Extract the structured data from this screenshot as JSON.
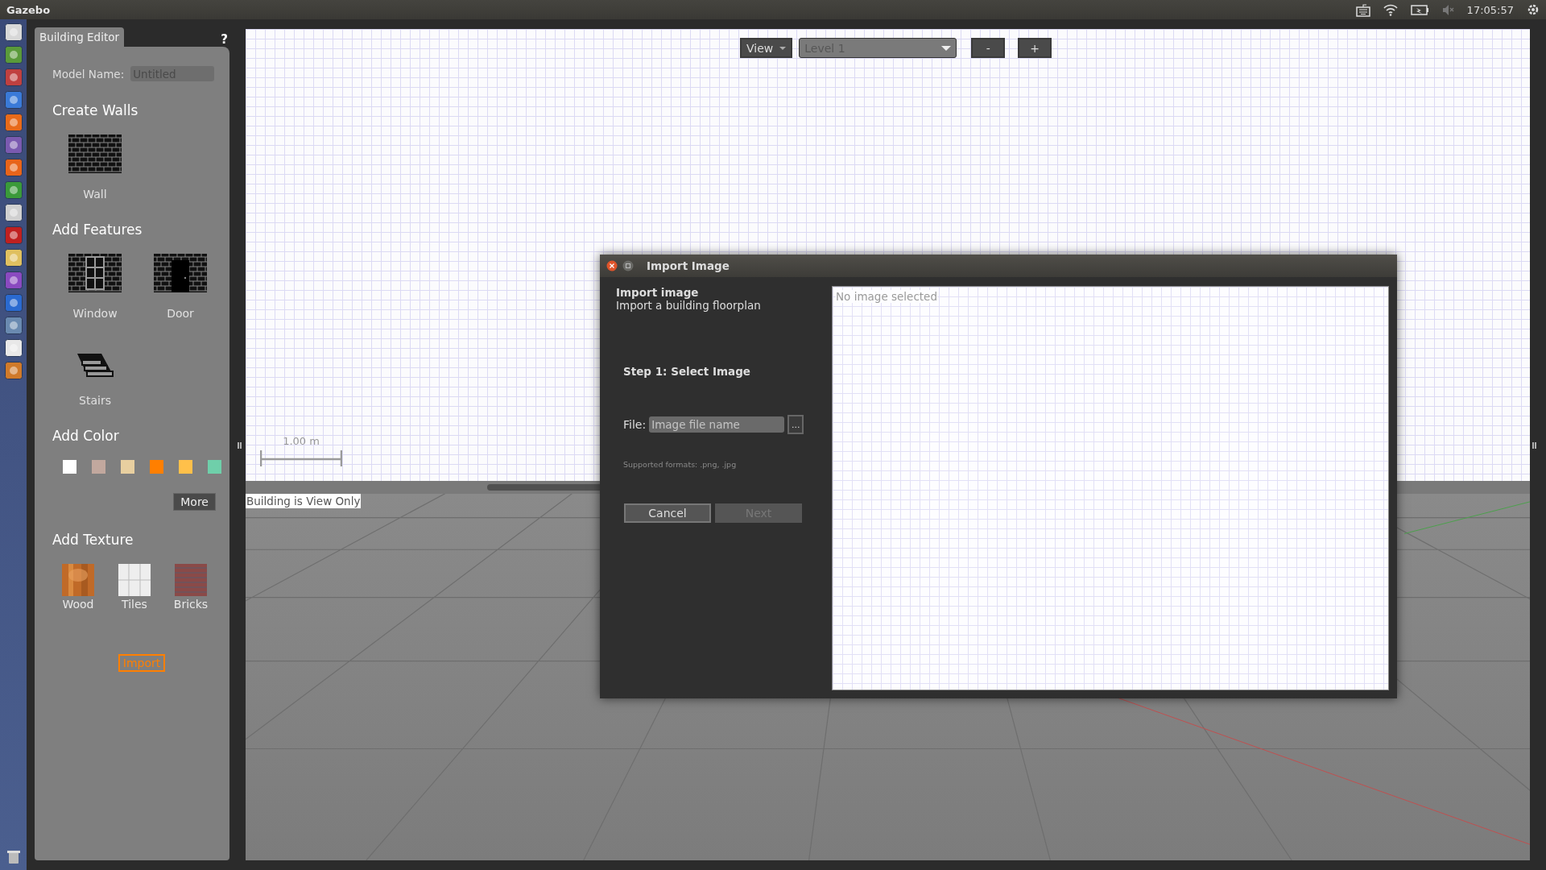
{
  "top_bar": {
    "title": "Gazebo",
    "clock": "17:05:57"
  },
  "building_editor": {
    "tab": "Building Editor",
    "help": "?",
    "model_name_label": "Model Name:",
    "model_name": "Untitled",
    "sections": [
      {
        "title": "Create Walls",
        "kind": "tools",
        "items": [
          {
            "label": "Wall",
            "kind": "wall"
          }
        ]
      },
      {
        "title": "Add Features",
        "kind": "tools",
        "items": [
          {
            "label": "Window",
            "kind": "window"
          },
          {
            "label": "Door",
            "kind": "door"
          },
          {
            "label": "Stairs",
            "kind": "stairs"
          }
        ]
      },
      {
        "title": "Add Color",
        "kind": "colors",
        "colors": [
          {
            "color": "#ffffff"
          },
          {
            "color": "#c2a89e"
          },
          {
            "color": "#e8cfa0"
          },
          {
            "color": "#ff7f00"
          },
          {
            "color": "#ffc04a"
          },
          {
            "color": "#6fcfaa"
          }
        ],
        "more": "More"
      },
      {
        "title": "Add Texture",
        "kind": "textures",
        "items": [
          {
            "label": "Wood",
            "kind": "wood"
          },
          {
            "label": "Tiles",
            "kind": "tiles"
          },
          {
            "label": "Bricks",
            "kind": "bricks"
          }
        ]
      }
    ],
    "import_button": "Import"
  },
  "editor_toolbar": {
    "view": "View",
    "level": "Level 1",
    "zoom_out": "-",
    "zoom_in": "+"
  },
  "scale_label": "1.00 m",
  "status_message": "Building is View Only",
  "dialog": {
    "title": "Import Image",
    "heading": "Import image",
    "subheading": "Import a building floorplan",
    "step": "Step 1: Select Image",
    "file_label": "File:",
    "file_placeholder": "Image file name",
    "browse": "...",
    "formats": "Supported formats: .png, .jpg",
    "buttons": [
      {
        "label": "Cancel",
        "disabled": false
      },
      {
        "label": "Next",
        "disabled": true
      }
    ],
    "preview_text": "No image selected"
  }
}
